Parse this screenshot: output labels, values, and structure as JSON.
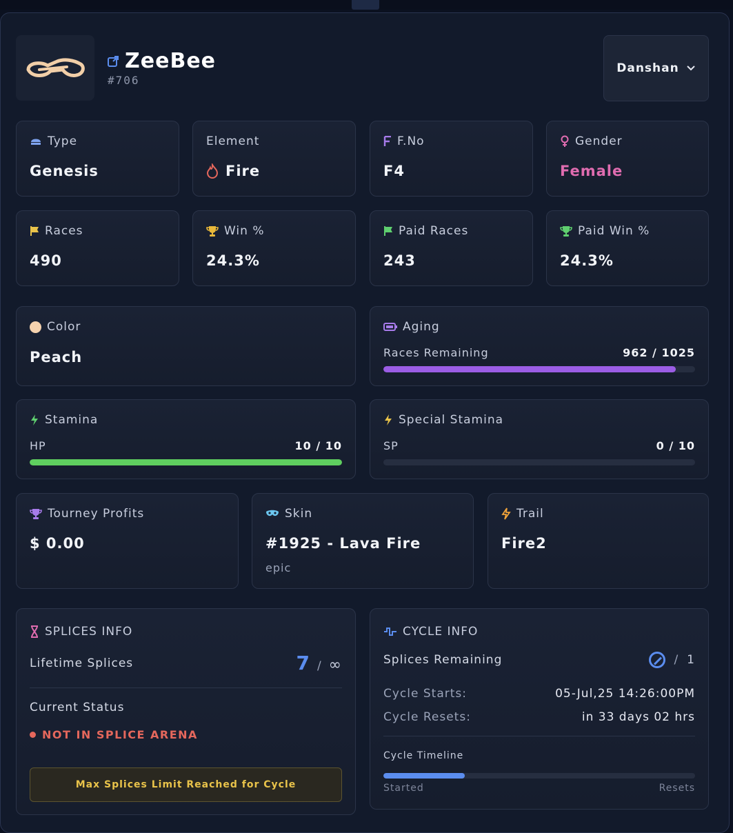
{
  "profile": {
    "name": "ZeeBee",
    "id": "#706",
    "account": "Danshan",
    "avatar_icon": "bike-logo-icon",
    "link_icon": "external-link-icon"
  },
  "stats": {
    "type": {
      "label": "Type",
      "value": "Genesis"
    },
    "element": {
      "label": "Element",
      "value": "Fire"
    },
    "fno": {
      "label": "F.No",
      "value": "F4"
    },
    "gender": {
      "label": "Gender",
      "value": "Female"
    },
    "races": {
      "label": "Races",
      "value": "490"
    },
    "win": {
      "label": "Win %",
      "value": "24.3%"
    },
    "paid_races": {
      "label": "Paid Races",
      "value": "243"
    },
    "paid_win": {
      "label": "Paid Win %",
      "value": "24.3%"
    },
    "color": {
      "label": "Color",
      "value": "Peach"
    }
  },
  "aging": {
    "label": "Aging",
    "sub_label": "Races Remaining",
    "value_text": "962 / 1025",
    "current": 962,
    "max": 1025
  },
  "stamina": {
    "label": "Stamina",
    "sub_label": "HP",
    "value_text": "10 / 10",
    "current": 10,
    "max": 10
  },
  "special_stamina": {
    "label": "Special Stamina",
    "sub_label": "SP",
    "value_text": "0 / 10",
    "current": 0,
    "max": 10
  },
  "tourney": {
    "label": "Tourney Profits",
    "value": "$ 0.00"
  },
  "skin": {
    "label": "Skin",
    "value": "#1925 - Lava Fire",
    "rarity": "epic"
  },
  "trail": {
    "label": "Trail",
    "value": "Fire2"
  },
  "splices": {
    "title": "SPLICES INFO",
    "lifetime_label": "Lifetime Splices",
    "lifetime_value": "7",
    "lifetime_sep": "/",
    "lifetime_max": "∞",
    "status_label": "Current Status",
    "status_value": "NOT IN SPLICE ARENA",
    "warning": "Max Splices Limit Reached for Cycle"
  },
  "cycle": {
    "title": "CYCLE INFO",
    "remaining_label": "Splices Remaining",
    "remaining_value": "0",
    "remaining_sep": "/",
    "remaining_max": "1",
    "starts_label": "Cycle Starts:",
    "starts_value": "05-Jul,25 14:26:00PM",
    "resets_label": "Cycle Resets:",
    "resets_value": "in 33 days 02 hrs",
    "timeline_label": "Cycle Timeline",
    "timeline_progress": 0.26,
    "timeline_start": "Started",
    "timeline_end": "Resets"
  },
  "colors": {
    "gender": "#e06cb0",
    "aging_bar": "#9b5de5",
    "stamina_bar": "#5fcf5f",
    "cycle_bar": "#5b8def",
    "accent_blue": "#5b8def",
    "warn_text": "#e9c34a",
    "status_red": "#e5675c"
  }
}
